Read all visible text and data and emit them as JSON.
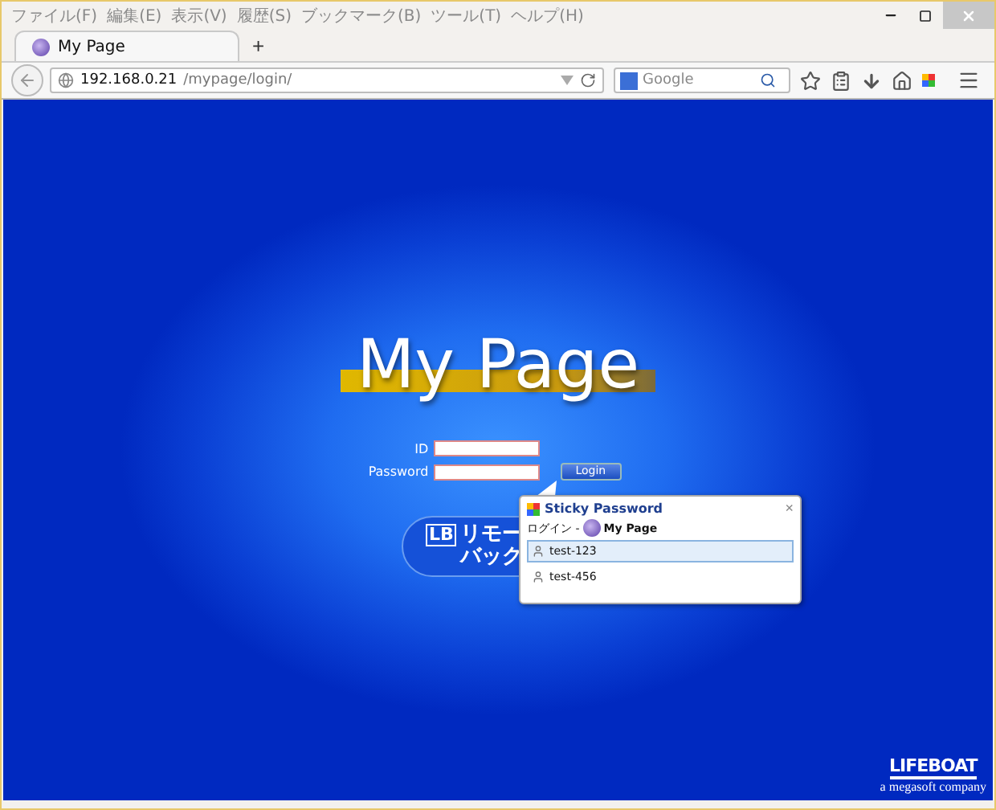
{
  "menu_bar": {
    "items": [
      "ファイル(F)",
      "編集(E)",
      "表示(V)",
      "履歴(S)",
      "ブックマーク(B)",
      "ツール(T)",
      "ヘルプ(H)"
    ]
  },
  "tabs": [
    {
      "label": "My Page",
      "selected": true
    }
  ],
  "new_tab": "+",
  "address_bar": {
    "host": "192.168.0.21",
    "path": "/mypage/login/"
  },
  "search": {
    "placeholder": "Google"
  },
  "page": {
    "title": "My Page",
    "id_label": "ID",
    "password_label": "Password",
    "login_button": "Login",
    "remote_button": {
      "logo": "LB",
      "line_1": "リモー",
      "line_2": "バック"
    }
  },
  "sticky_popup": {
    "title": "Sticky Password",
    "close": "×",
    "site_prefix": "ログイン - ",
    "site": "My Page",
    "accounts": [
      {
        "name": "test-123",
        "selected": true
      },
      {
        "name": "test-456",
        "selected": false
      }
    ]
  },
  "footer_logo": {
    "name": "LIFEBOAT",
    "tagline": "a megasoft company"
  }
}
